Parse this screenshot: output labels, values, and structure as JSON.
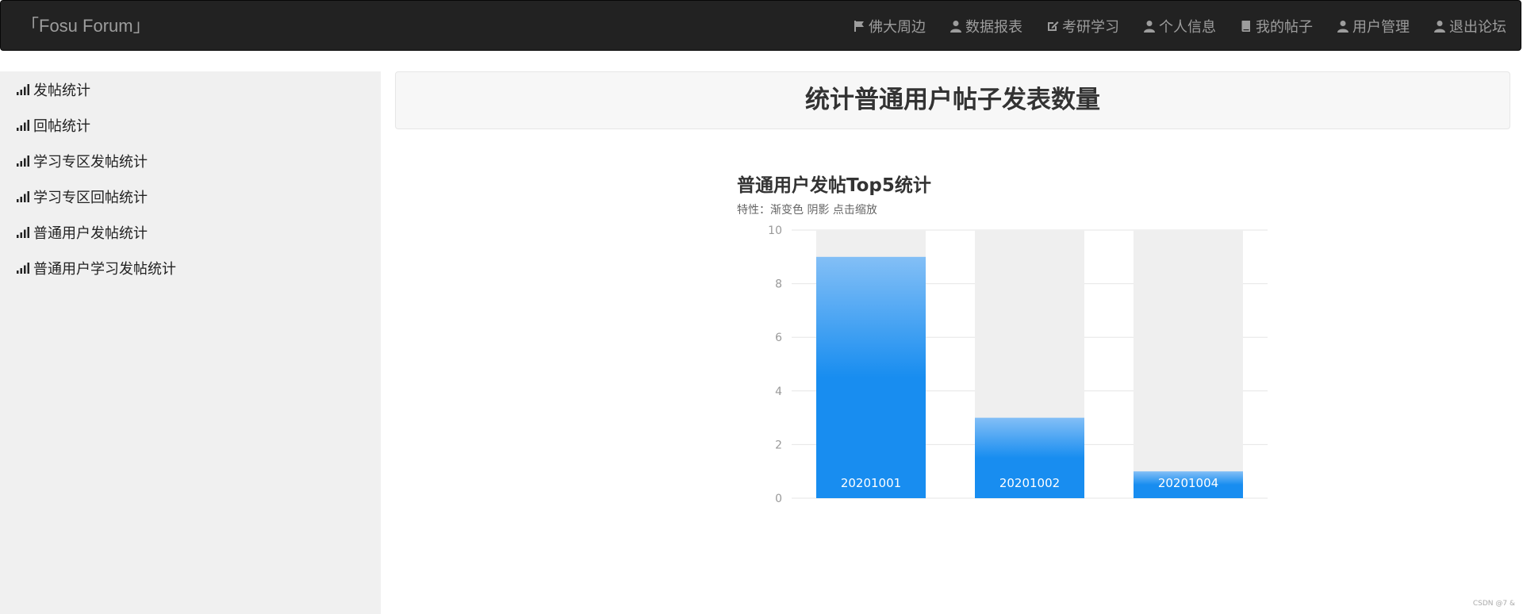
{
  "navbar": {
    "brand": "「Fosu Forum」",
    "items": [
      {
        "label": "佛大周边",
        "icon": "flag-icon"
      },
      {
        "label": "数据报表",
        "icon": "user-icon"
      },
      {
        "label": "考研学习",
        "icon": "edit-icon"
      },
      {
        "label": "个人信息",
        "icon": "user-icon"
      },
      {
        "label": "我的帖子",
        "icon": "book-icon"
      },
      {
        "label": "用户管理",
        "icon": "user-icon"
      },
      {
        "label": "退出论坛",
        "icon": "user-icon"
      }
    ]
  },
  "sidebar": {
    "items": [
      {
        "label": "发帖统计"
      },
      {
        "label": "回帖统计"
      },
      {
        "label": "学习专区发帖统计"
      },
      {
        "label": "学习专区回帖统计"
      },
      {
        "label": "普通用户发帖统计"
      },
      {
        "label": "普通用户学习发帖统计"
      }
    ]
  },
  "main": {
    "heading": "统计普通用户帖子发表数量"
  },
  "chart_data": {
    "type": "bar",
    "title": "普通用户发帖Top5统计",
    "subtitle": "特性：渐变色 阴影 点击缩放",
    "categories": [
      "20201001",
      "20201002",
      "20201004"
    ],
    "values": [
      9,
      3,
      1
    ],
    "ylim": [
      0,
      10
    ],
    "yticks": [
      0,
      2,
      4,
      6,
      8,
      10
    ],
    "grid": true,
    "background_bars": true,
    "colors": {
      "bar_top": "#83bff6",
      "bar_mid": "#188df0",
      "bar_bottom": "#188df0",
      "shadow": "#efefef",
      "grid": "#e6e6e6",
      "axis_label": "#999999"
    }
  },
  "footer": {
    "watermark": "CSDN @7 &"
  }
}
